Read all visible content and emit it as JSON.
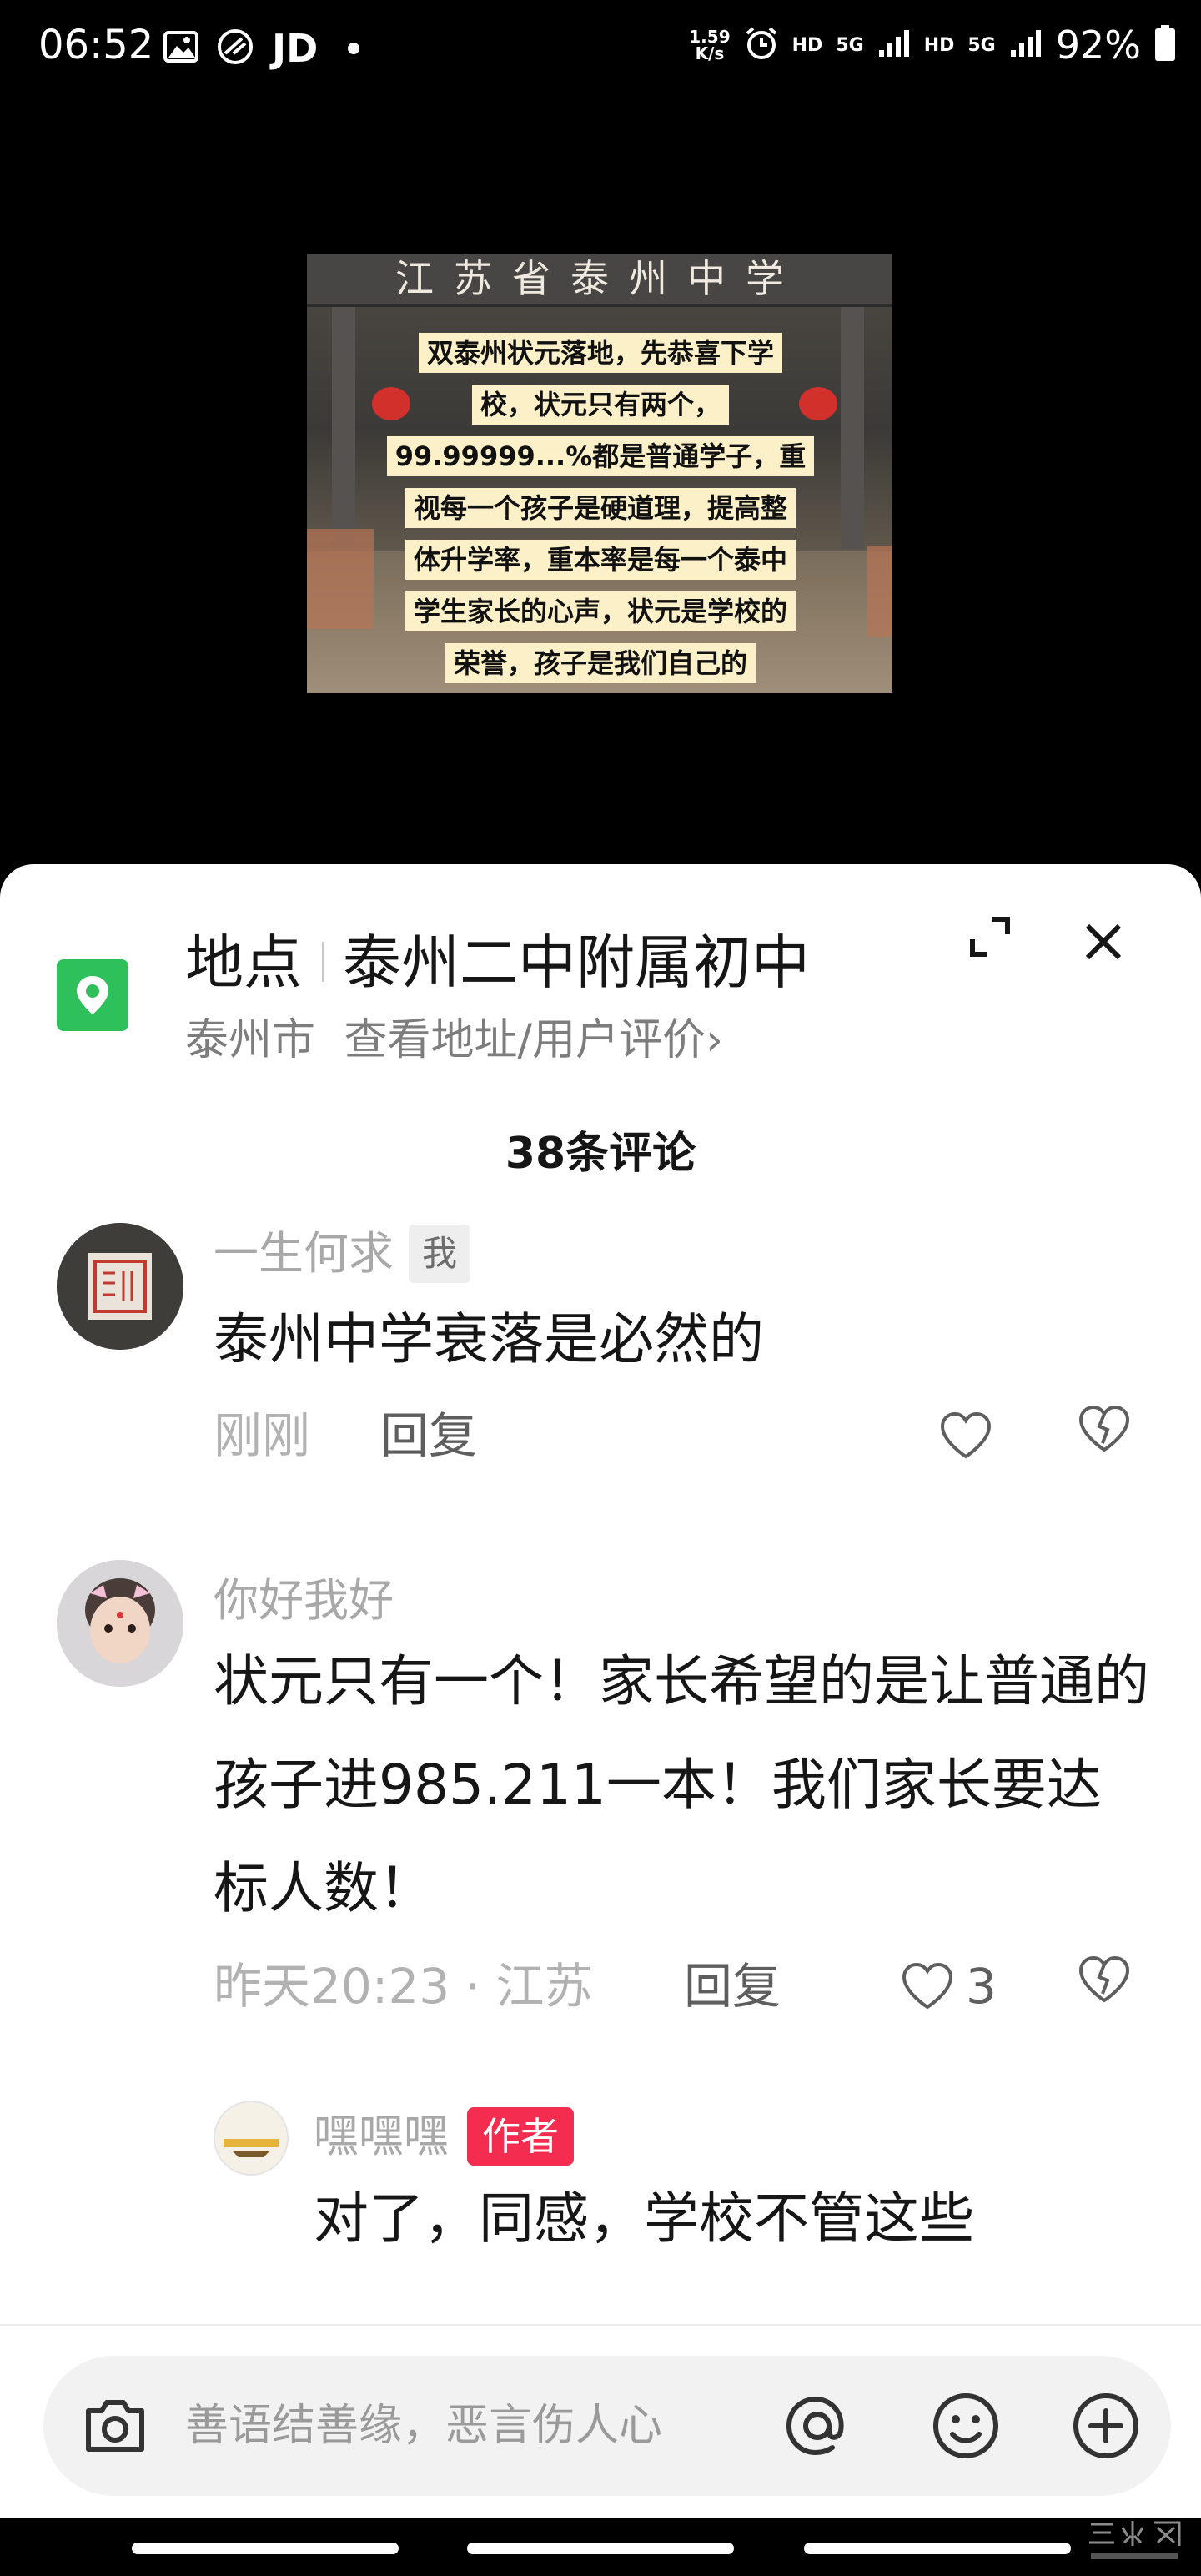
{
  "status_bar": {
    "time": "06:52",
    "app_badge": "JD",
    "net_speed_value": "1.59",
    "net_speed_unit": "K/s",
    "hd1": "HD",
    "net1": "5G",
    "hd2": "HD",
    "net2": "5G",
    "battery": "92%",
    "icons": [
      "gallery-icon",
      "app-icon",
      "alarm-icon",
      "signal-icon",
      "battery-icon"
    ]
  },
  "video": {
    "banner_text": "江苏省泰州中学",
    "overlay_lines": [
      "双泰州状元落地，先恭喜下学",
      "校，状元只有两个，",
      "99.99999...%都是普通学子，重",
      "视每一个孩子是硬道理，提高整",
      "体升学率，重本率是每一个泰中",
      "学生家长的心声，状元是学校的",
      "荣誉，孩子是我们自己的"
    ]
  },
  "location": {
    "label": "地点",
    "name": "泰州二中附属初中",
    "city": "泰州市",
    "link": "查看地址/用户评价",
    "chevron": "›"
  },
  "comments_header": {
    "count_label": "38条评论"
  },
  "comments": [
    {
      "username": "一生何求",
      "badge": "我",
      "text": "泰州中学衰落是必然的",
      "time": "刚刚",
      "reply_label": "回复",
      "likes": ""
    },
    {
      "username": "你好我好",
      "text": "状元只有一个！家长希望的是让普通的孩子进985.211一本！我们家长要达标人数！",
      "time_location": "昨天20:23 · 江苏",
      "reply_label": "回复",
      "likes": "3"
    }
  ],
  "reply_preview": {
    "username": "嘿嘿嘿",
    "badge": "作者",
    "text": "对了，同感，学校不管这些"
  },
  "input": {
    "placeholder": "善语结善缘，恶言伤人心"
  },
  "watermark": {
    "line1": "三水网",
    "line2": "WWW.JYSS.NET"
  },
  "colors": {
    "sheet_bg": "#ffffff",
    "location_green": "#2ec15b",
    "author_badge": "#f42c50"
  }
}
